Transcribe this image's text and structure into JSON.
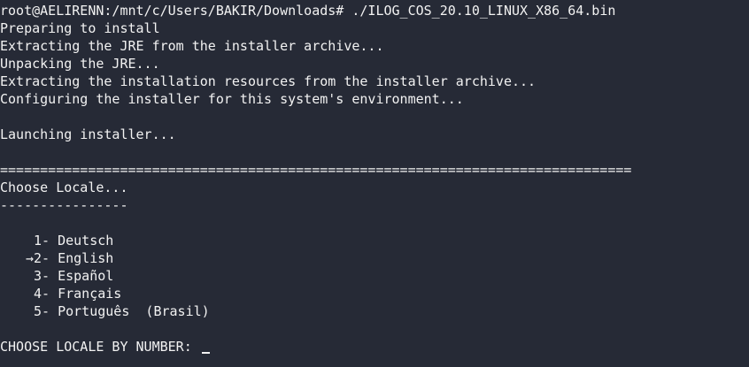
{
  "command_line": {
    "prompt": "root@AELIRENN:/mnt/c/Users/BAKIR/Downloads#",
    "command": " ./ILOG_COS_20.10_LINUX_X86_64.bin"
  },
  "output_lines": [
    "Preparing to install",
    "Extracting the JRE from the installer archive...",
    "Unpacking the JRE...",
    "Extracting the installation resources from the installer archive...",
    "Configuring the installer for this system's environment...",
    "",
    "Launching installer...",
    ""
  ],
  "separator": "===============================================================================",
  "section_title": "Choose Locale...",
  "section_underline": "----------------",
  "locales": [
    {
      "marker": "",
      "number": "1-",
      "label": "Deutsch"
    },
    {
      "marker": "→",
      "number": "2-",
      "label": "English"
    },
    {
      "marker": "",
      "number": "3-",
      "label": "Español"
    },
    {
      "marker": "",
      "number": "4-",
      "label": "Français"
    },
    {
      "marker": "",
      "number": "5-",
      "label": "Português  (Brasil)"
    }
  ],
  "input_prompt": "CHOOSE LOCALE BY NUMBER: ",
  "colors": {
    "background": "#262a36",
    "text": "#f2f2f2"
  }
}
